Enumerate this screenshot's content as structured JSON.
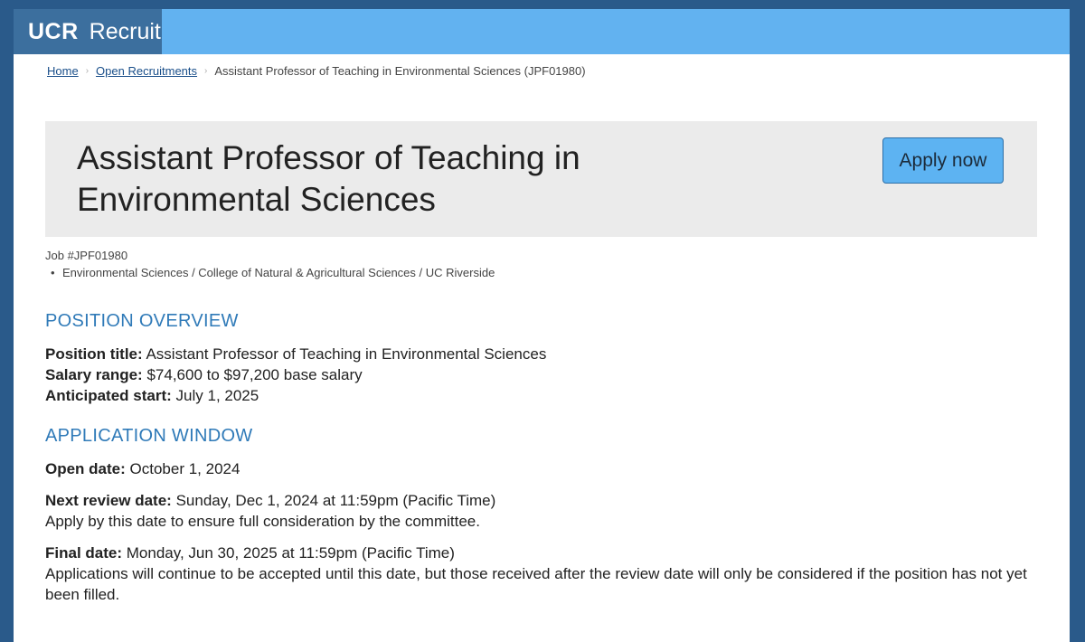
{
  "brand": {
    "logo_bold": "UCR",
    "logo_text": "Recruit"
  },
  "breadcrumb": {
    "home": "Home",
    "open_recruitments": "Open Recruitments",
    "current": "Assistant Professor of Teaching in Environmental Sciences (JPF01980)",
    "separator": "›"
  },
  "hero": {
    "title": "Assistant Professor of Teaching in Environmental Sciences",
    "apply_label": "Apply now"
  },
  "job": {
    "number": "Job #JPF01980",
    "department": "Environmental Sciences / College of Natural & Agricultural Sciences / UC Riverside",
    "bullet": "•"
  },
  "overview": {
    "heading": "POSITION OVERVIEW",
    "title_label": "Position title:",
    "title_value": "Assistant Professor of Teaching in Environmental Sciences",
    "salary_label": "Salary range:",
    "salary_value": "$74,600 to $97,200 base salary",
    "start_label": "Anticipated start:",
    "start_value": "July 1, 2025"
  },
  "window": {
    "heading": "APPLICATION WINDOW",
    "open_label": "Open date:",
    "open_value": "October 1, 2024",
    "review_label": "Next review date:",
    "review_value": "Sunday, Dec 1, 2024 at 11:59pm (Pacific Time)",
    "review_note": "Apply by this date to ensure full consideration by the committee.",
    "final_label": "Final date:",
    "final_value": "Monday, Jun 30, 2025 at 11:59pm (Pacific Time)",
    "final_note": "Applications will continue to be accepted until this date, but those received after the review date will only be considered if the position has not yet been filled."
  }
}
